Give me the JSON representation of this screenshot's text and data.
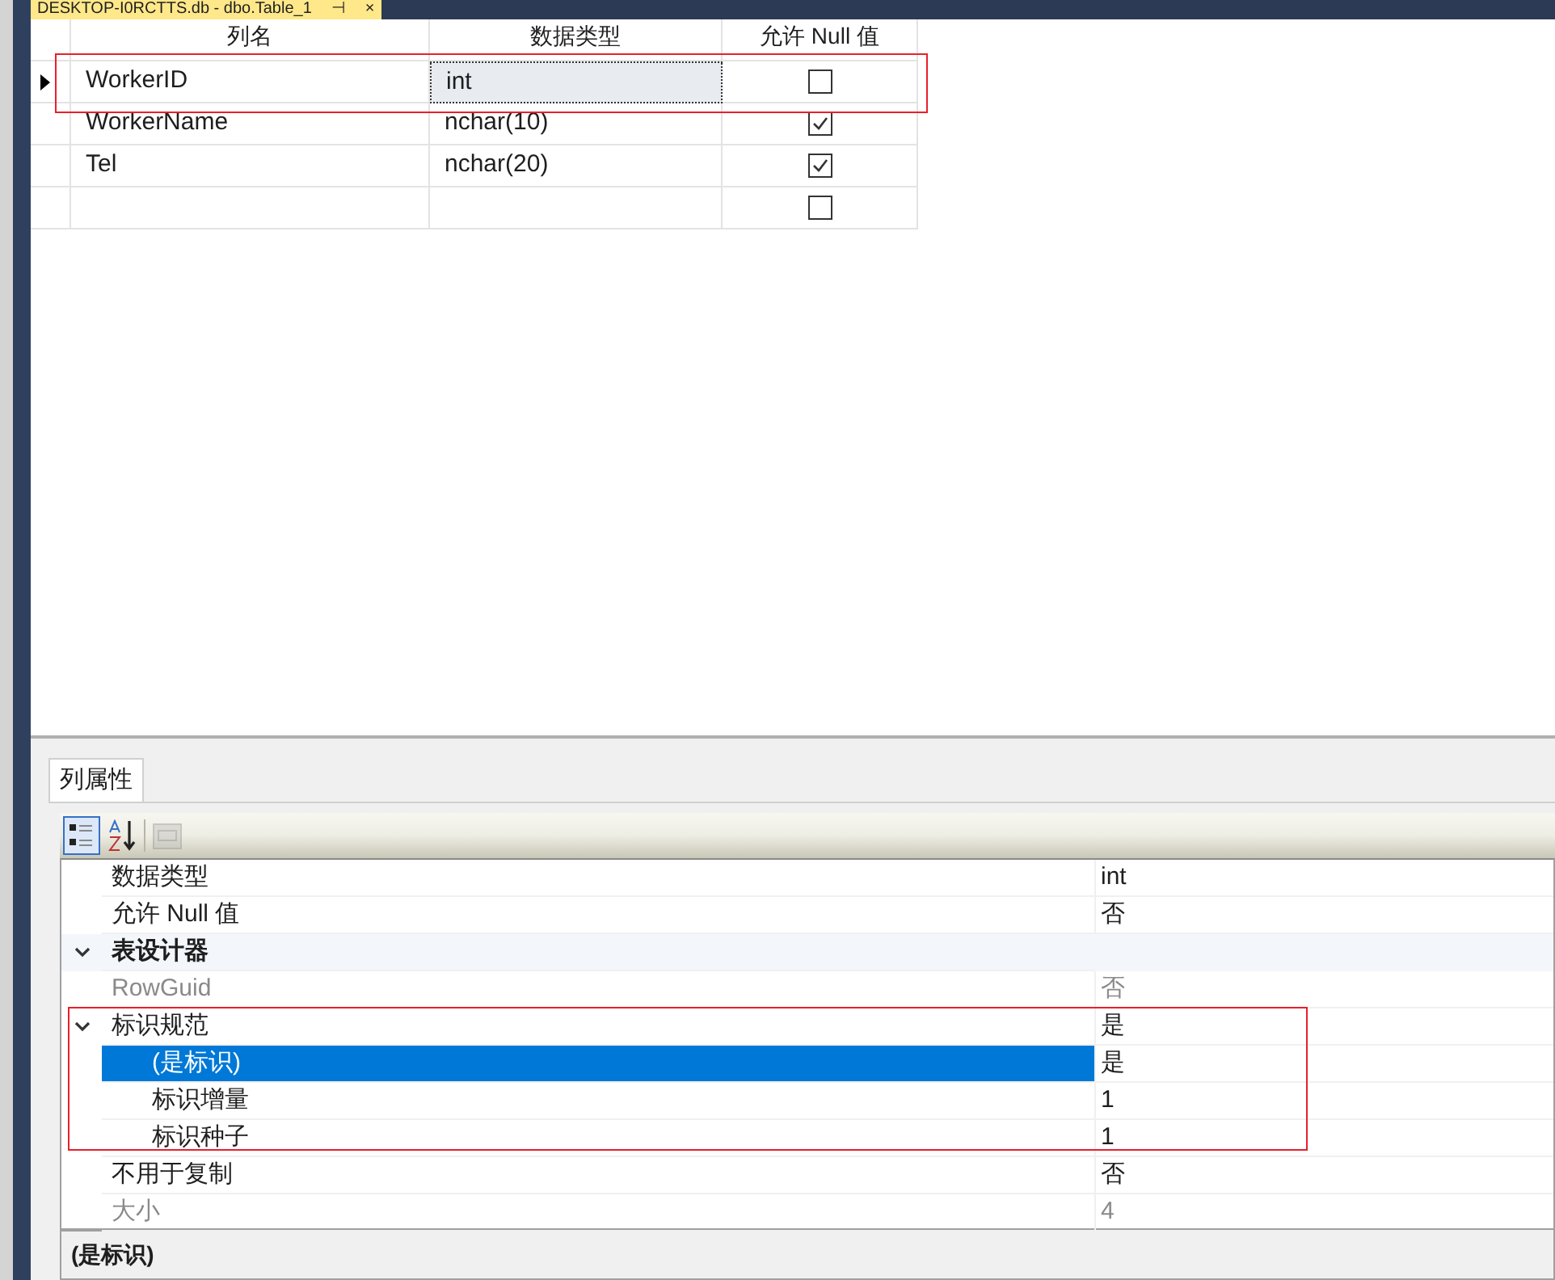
{
  "document_tab": {
    "title": "DESKTOP-I0RCTTS.db - dbo.Table_1",
    "pin": "⊣",
    "close": "×"
  },
  "table": {
    "columns": [
      "列名",
      "数据类型",
      "允许 Null 值"
    ],
    "rows": [
      {
        "name": "WorkerID",
        "type": "int",
        "allow_null": false,
        "selected": true
      },
      {
        "name": "WorkerName",
        "type": "nchar(10)",
        "allow_null": true,
        "selected": false
      },
      {
        "name": "Tel",
        "type": "nchar(20)",
        "allow_null": true,
        "selected": false
      },
      {
        "name": "",
        "type": "",
        "allow_null": false,
        "selected": false
      }
    ]
  },
  "properties_tab": {
    "label": "列属性",
    "selected": true
  },
  "toolbar": {
    "categorized": {
      "selected": true
    },
    "alphabetical": {
      "selected": false
    },
    "pages": {
      "disabled": true
    }
  },
  "properties": [
    {
      "kind": "property",
      "name": "数据类型",
      "value": "int",
      "disabled": false,
      "selected": false
    },
    {
      "kind": "property",
      "name": "允许 Null 值",
      "value": "否",
      "disabled": false,
      "selected": false
    },
    {
      "kind": "category",
      "name": "表设计器",
      "expanded": true,
      "children": [
        {
          "kind": "property",
          "name": "RowGuid",
          "value": "否",
          "disabled": true,
          "selected": false
        },
        {
          "kind": "group",
          "name": "标识规范",
          "value": "是",
          "expanded": true,
          "disabled": false,
          "selected": false,
          "children": [
            {
              "kind": "property",
              "name": "(是标识)",
              "value": "是",
              "disabled": false,
              "selected": true
            },
            {
              "kind": "property",
              "name": "标识增量",
              "value": "1",
              "disabled": false,
              "selected": false
            },
            {
              "kind": "property",
              "name": "标识种子",
              "value": "1",
              "disabled": false,
              "selected": false
            }
          ]
        },
        {
          "kind": "property",
          "name": "不用于复制",
          "value": "否",
          "disabled": false,
          "selected": false
        },
        {
          "kind": "property",
          "name": "大小",
          "value": "4",
          "disabled": true,
          "selected": false
        }
      ]
    }
  ],
  "description": {
    "title": "(是标识)"
  }
}
